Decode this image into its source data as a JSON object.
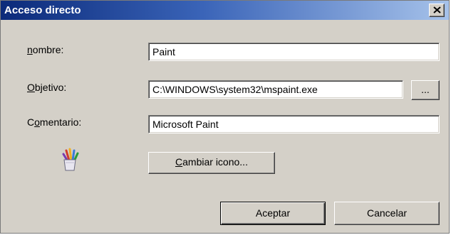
{
  "window": {
    "title": "Acceso directo",
    "close_glyph": "×"
  },
  "fields": {
    "nombre": {
      "label_accel": "n",
      "label_rest": "ombre:",
      "value": "Paint"
    },
    "objetivo": {
      "label_accel": "O",
      "label_rest": "bjetivo:",
      "value": "C:\\WINDOWS\\system32\\mspaint.exe"
    },
    "comentario": {
      "label_pre": "C",
      "label_accel": "o",
      "label_rest": "mentario:",
      "value": "Microsoft Paint"
    }
  },
  "buttons": {
    "browse_label": "...",
    "change_icon": {
      "accel": "C",
      "rest": "ambiar icono..."
    },
    "accept_label": "Aceptar",
    "cancel_label": "Cancelar"
  },
  "icons": {
    "app_icon": "paint-brushes-cup-icon",
    "close_icon": "close-icon"
  }
}
